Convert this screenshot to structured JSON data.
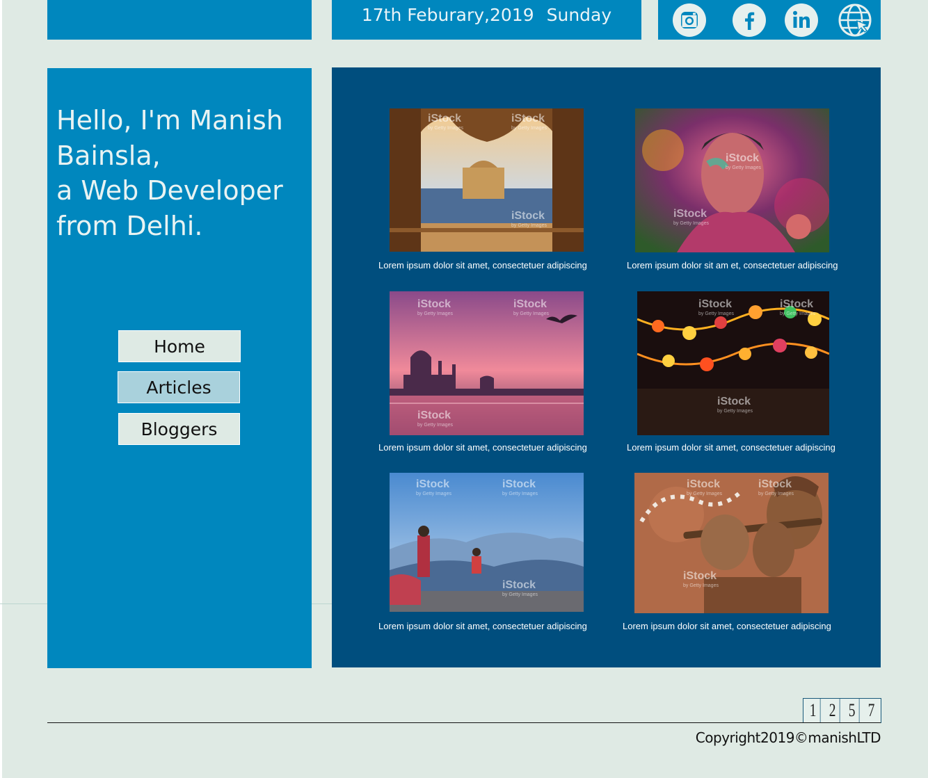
{
  "header": {
    "date": "17th Feburary,2019",
    "day": "Sunday",
    "social": [
      "instagram-icon",
      "facebook-icon",
      "linkedin-icon",
      "globe-icon"
    ]
  },
  "sidebar": {
    "intro_lines": [
      "Hello, I'm Manish",
      "Bainsla,",
      "a Web Developer",
      "from Delhi."
    ],
    "nav": {
      "home": "Home",
      "articles": "Articles",
      "bloggers": "Bloggers"
    }
  },
  "gallery": {
    "watermark": "iStock",
    "watermark_sub": "by Getty Images",
    "items": [
      {
        "caption": "Lorem ipsum dolor sit amet, consectetuer adipiscing"
      },
      {
        "caption": "Lorem ipsum dolor sit am    et, consectetuer adipiscing"
      },
      {
        "caption": "Lorem ipsum dolor sit amet, consectetuer adipiscing"
      },
      {
        "caption": "Lorem ipsum dolor sit amet, consectetuer adipiscing"
      },
      {
        "caption": "Lorem ipsum dolor sit amet, consectetuer adipiscing"
      },
      {
        "caption": "Lorem ipsum dolor sit amet, consectetuer adipiscing"
      }
    ]
  },
  "pagination": [
    "1",
    "2",
    "5",
    "7"
  ],
  "footer": {
    "copyright": "Copyright2019©manishLTD"
  },
  "colors": {
    "primary": "#0087be",
    "dark": "#004e7e",
    "background": "#dfeae4",
    "active_nav": "#a9d1dc"
  }
}
